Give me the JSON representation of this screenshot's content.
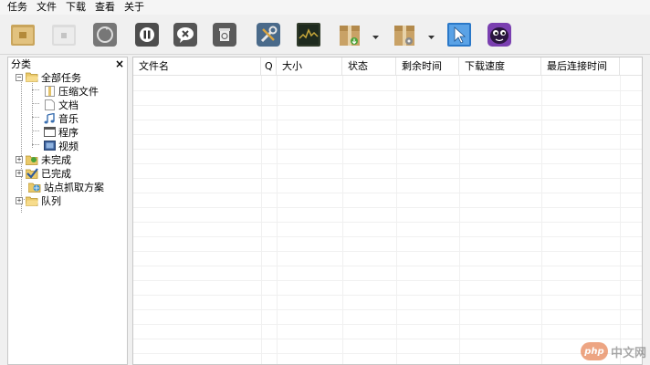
{
  "menu": [
    "任务",
    "文件",
    "下载",
    "查看",
    "关于"
  ],
  "toolbar": {
    "icons": [
      "add-task-icon",
      "new-icon",
      "reload-icon",
      "pause-icon",
      "stop-icon",
      "delete-icon",
      "options-icon",
      "monitor-icon",
      "download-box-icon",
      "settings-box-icon",
      "cursor-icon",
      "mascot-icon"
    ]
  },
  "sidebar": {
    "title": "分类",
    "close": "×",
    "tree": {
      "all": "全部任务",
      "children": [
        "压缩文件",
        "文档",
        "音乐",
        "程序",
        "视频"
      ],
      "incomplete": "未完成",
      "complete": "已完成",
      "site_grab": "站点抓取方案",
      "queue": "队列",
      "expand_glyph": "+",
      "collapse_glyph": "−"
    }
  },
  "table": {
    "columns": [
      "文件名",
      "Q",
      "大小",
      "状态",
      "剩余时间",
      "下载速度",
      "最后连接时间"
    ]
  },
  "watermark": {
    "logo": "php",
    "text": "中文网"
  },
  "colors": {
    "accent": "#e05d1e",
    "border": "#c8c8c8"
  }
}
